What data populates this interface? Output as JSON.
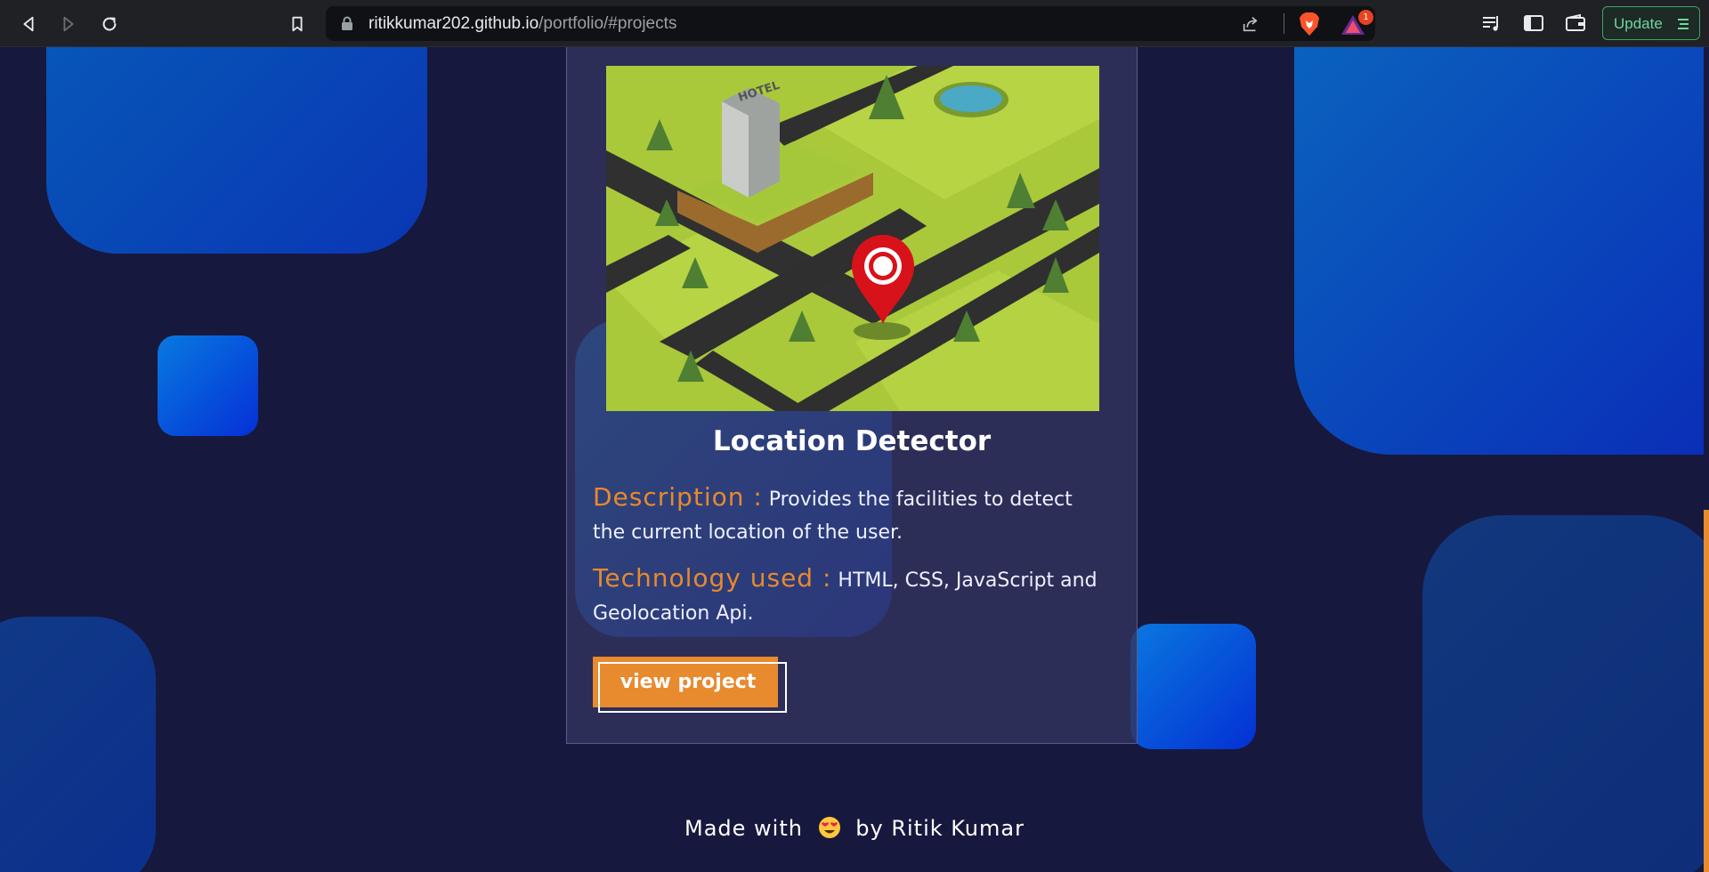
{
  "browser": {
    "url_host": "ritikkumar202.github.io",
    "url_path": "/portfolio/#projects",
    "rewards_badge": "1",
    "update_label": "Update"
  },
  "project": {
    "title": "Location Detector",
    "description_label": "Description :",
    "description_text": " Provides the facilities to detect the current location of the user.",
    "technology_label": "Technology used :",
    "technology_text": " HTML, CSS, JavaScript and Geolocation Api.",
    "button_label": "view project",
    "image_sign_text": "HOTEL"
  },
  "footer": {
    "prefix": "Made with",
    "suffix": "by Ritik Kumar"
  },
  "colors": {
    "background": "#17183d",
    "card": "#32345f",
    "accent_orange": "#e88a2e",
    "blob_blue": "#0a3ab8"
  }
}
